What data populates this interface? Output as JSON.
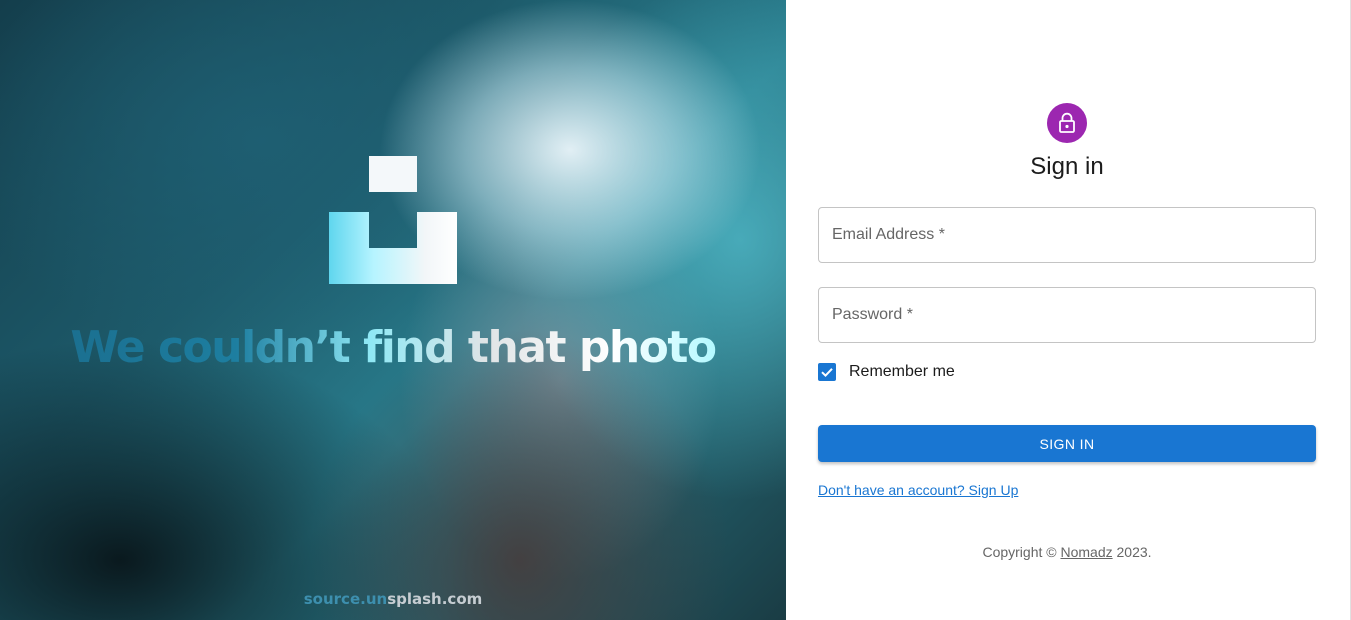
{
  "hero": {
    "headline": "We couldn’t find that photo",
    "source_part1": "source.un",
    "source_part2": "splash.com",
    "logo_icon": "unsplash-logo"
  },
  "signin": {
    "icon": "lock-icon",
    "accent_color": "#9c27b0",
    "title": "Sign in",
    "email_label": "Email Address *",
    "password_label": "Password *",
    "remember_label": "Remember me",
    "remember_checked": true,
    "button_label": "SIGN IN",
    "button_color": "#1976d2",
    "signup_link": "Don't have an account? Sign Up",
    "copyright_prefix": "Copyright ©",
    "copyright_brand": "Nomadz",
    "copyright_suffix": "2023."
  }
}
